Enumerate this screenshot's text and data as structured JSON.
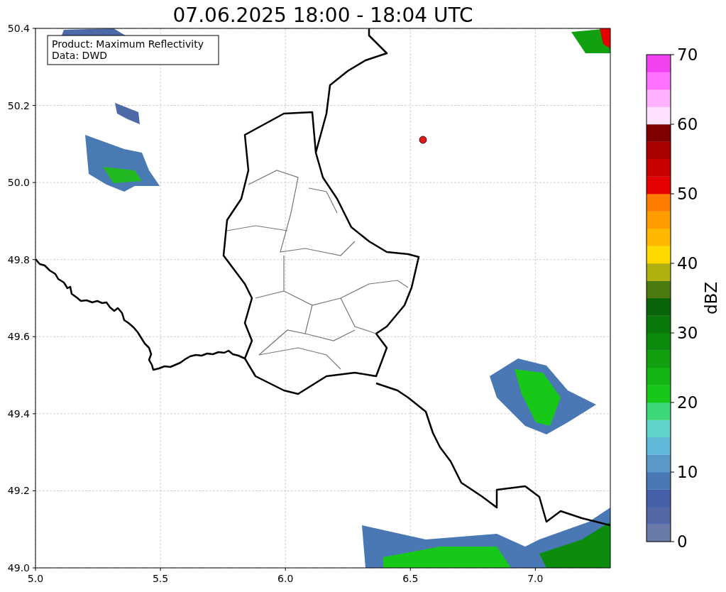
{
  "title": "07.06.2025 18:00 - 18:04 UTC",
  "map": {
    "info_lines": [
      "Product: Maximum Reflectivity",
      "Data: DWD"
    ],
    "xticks": [
      "5.0",
      "5.5",
      "6.0",
      "6.5",
      "7.0"
    ],
    "yticks": [
      "50.4",
      "50.2",
      "50.0",
      "49.8",
      "49.6",
      "49.4",
      "49.2",
      "49.0"
    ]
  },
  "colorbar": {
    "label": "dBZ",
    "ticks": [
      "70",
      "60",
      "50",
      "40",
      "30",
      "20",
      "10",
      "0"
    ],
    "steps": [
      {
        "color": "#6a7aa8"
      },
      {
        "color": "#5468a8"
      },
      {
        "color": "#4460a8"
      },
      {
        "color": "#4a78b4"
      },
      {
        "color": "#5a98c8"
      },
      {
        "color": "#62b8d8"
      },
      {
        "color": "#60d4c8"
      },
      {
        "color": "#3cd878"
      },
      {
        "color": "#18c818"
      },
      {
        "color": "#14b414"
      },
      {
        "color": "#10a010"
      },
      {
        "color": "#0c8c0c"
      },
      {
        "color": "#0a780a"
      },
      {
        "color": "#086408"
      },
      {
        "color": "#4a7a10"
      },
      {
        "color": "#b0b010"
      },
      {
        "color": "#ffd800"
      },
      {
        "color": "#ffb800"
      },
      {
        "color": "#ff9c00"
      },
      {
        "color": "#ff7c00"
      },
      {
        "color": "#e40000"
      },
      {
        "color": "#c80000"
      },
      {
        "color": "#a80000"
      },
      {
        "color": "#800000"
      },
      {
        "color": "#ffe0ff"
      },
      {
        "color": "#ffb0ff"
      },
      {
        "color": "#ff70ff"
      },
      {
        "color": "#f040f0"
      }
    ]
  }
}
